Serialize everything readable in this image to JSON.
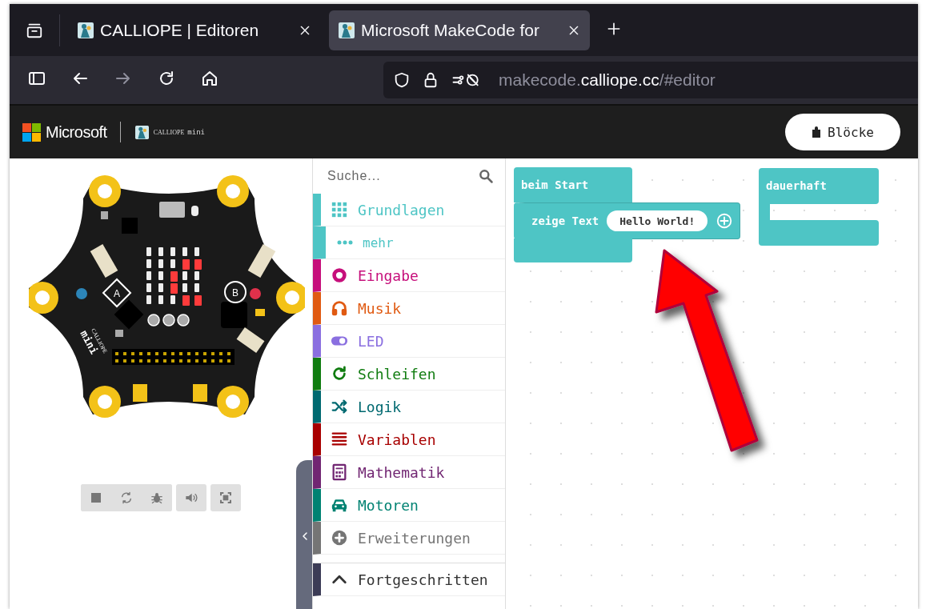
{
  "browser": {
    "tabs": [
      {
        "title": "CALLIOPE | Editoren",
        "selected": false
      },
      {
        "title": "Microsoft MakeCode for",
        "selected": true
      }
    ],
    "nav_buttons": [
      {
        "kind": "sidebar",
        "disabled": false
      },
      {
        "kind": "back",
        "disabled": false
      },
      {
        "kind": "forward",
        "disabled": true
      },
      {
        "kind": "reload",
        "disabled": false
      },
      {
        "kind": "home",
        "disabled": false
      }
    ],
    "url": {
      "prefix": "makecode.",
      "domain": "calliope.cc",
      "suffix": "/#editor"
    }
  },
  "app_header": {
    "brand": "Microsoft",
    "product_name": "CALLIOPE",
    "product_suffix": "mini",
    "mode_button": "Blöcke"
  },
  "simulator": {
    "button_a": "A",
    "button_b": "B",
    "board_logo": [
      "CALLIOPE",
      "mini"
    ],
    "leds": [
      [
        false,
        false,
        false,
        false,
        false
      ],
      [
        false,
        false,
        false,
        true,
        true
      ],
      [
        false,
        false,
        true,
        false,
        false
      ],
      [
        false,
        false,
        true,
        false,
        false
      ],
      [
        false,
        false,
        false,
        true,
        true
      ]
    ]
  },
  "toolbox": {
    "search_placeholder": "Suche...",
    "categories": [
      {
        "label": "Grundlagen",
        "color": "#4ec5c5",
        "children": [
          {
            "label": "mehr"
          }
        ]
      },
      {
        "label": "Eingabe",
        "color": "#c60f7b"
      },
      {
        "label": "Musik",
        "color": "#e05a12"
      },
      {
        "label": "LED",
        "color": "#8a6fe0"
      },
      {
        "label": "Schleifen",
        "color": "#107c10"
      },
      {
        "label": "Logik",
        "color": "#006970"
      },
      {
        "label": "Variablen",
        "color": "#a80000"
      },
      {
        "label": "Mathematik",
        "color": "#712672"
      },
      {
        "label": "Motoren",
        "color": "#008272"
      },
      {
        "label": "Erweiterungen",
        "color": "#757575"
      }
    ],
    "advanced": {
      "label": "Fortgeschritten",
      "color": "#3c3c56",
      "expanded": true
    }
  },
  "workspace": {
    "blocks": [
      {
        "kind": "event",
        "label": "beim Start",
        "statements": [
          {
            "label": "zeige Text",
            "value": "Hello World!"
          }
        ]
      },
      {
        "kind": "loop",
        "label": "dauerhaft"
      }
    ]
  }
}
